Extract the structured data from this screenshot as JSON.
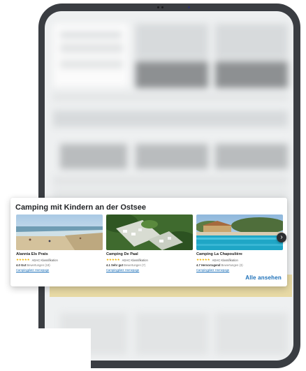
{
  "section": {
    "title": "Camping mit Kindern an der Ostsee",
    "show_all_label": "Alle ansehen"
  },
  "campsites": [
    {
      "name": "Alannia Els Prats",
      "stars": "★★★★★",
      "classification": "ADAC Klassifikation",
      "score": "4.0",
      "score_label": "Gut",
      "reviews": "Bewertungen (18)",
      "link": "Campingplatz Homepage"
    },
    {
      "name": "Camping De Paal",
      "stars": "★★★★★",
      "classification": "ADAC Klassifikation",
      "score": "4.1",
      "score_label": "Sehr gut",
      "reviews": "Bewertungen (7)",
      "link": "Campingplatz Homepage"
    },
    {
      "name": "Camping La Chapoulière",
      "stars": "★★★★★",
      "classification": "ADAC Klassifikation",
      "score": "4.7",
      "score_label": "Hervorragend",
      "reviews": "Bewertungen (3)",
      "link": "Campingplatz Homepage"
    }
  ],
  "icons": {
    "next": "chevron-right-icon",
    "next_glyph": "›"
  },
  "colors": {
    "link": "#1b6fb8",
    "stars": "#f0b400",
    "device": "#3a3d42",
    "highlight_band": "#e7d9a4"
  }
}
